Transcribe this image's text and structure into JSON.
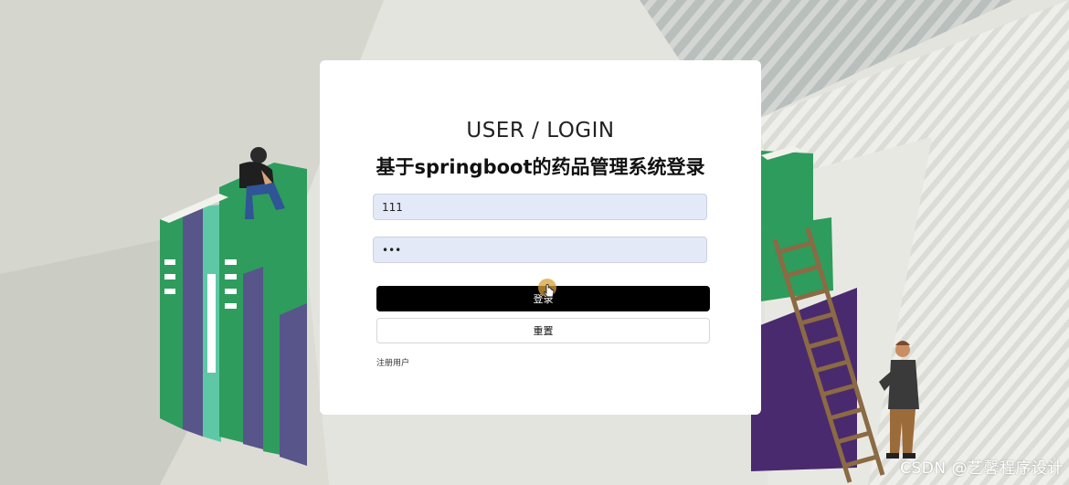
{
  "login": {
    "heading": "USER / LOGIN",
    "system_title": "基于springboot的药品管理系统登录",
    "username_value": "111",
    "password_value": "111",
    "login_button": "登录",
    "reset_button": "重置",
    "register_link": "注册用户"
  },
  "watermark": "CSDN @艺馨程序设计",
  "colors": {
    "input_bg": "#e3e9f6",
    "login_button_bg": "#000000",
    "book_green": "#2f9e5e",
    "book_purple": "#4a2a6e"
  }
}
